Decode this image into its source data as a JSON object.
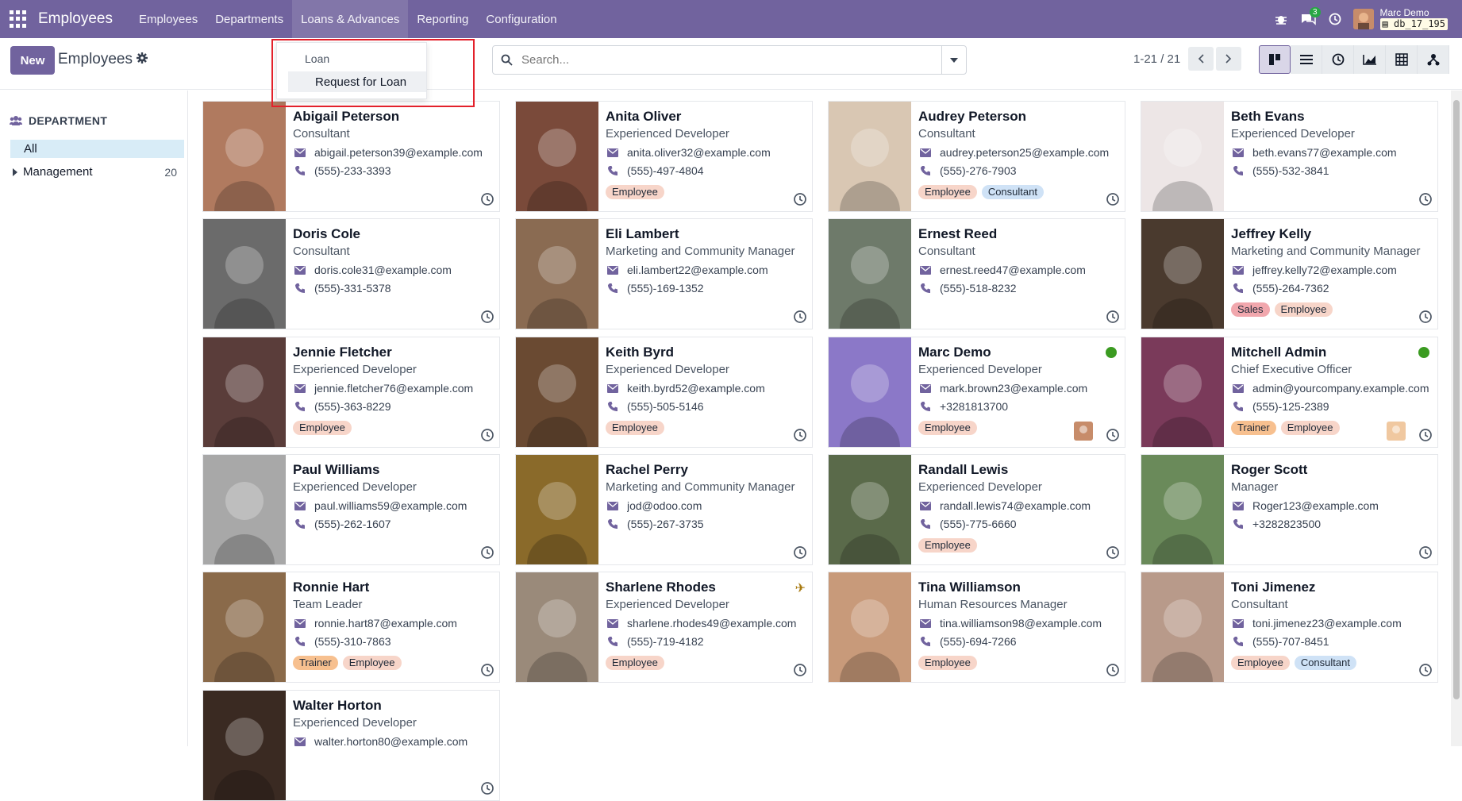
{
  "navbar": {
    "brand": "Employees",
    "menu": [
      "Employees",
      "Departments",
      "Loans & Advances",
      "Reporting",
      "Configuration"
    ],
    "messages_count": "3",
    "user_name": "Marc Demo",
    "db_name": "db_17_195"
  },
  "control": {
    "new_label": "New",
    "title": "Employees",
    "search_placeholder": "Search...",
    "pager": "1-21 / 21"
  },
  "loans_dropdown": {
    "header": "Loan",
    "item": "Request for Loan"
  },
  "sidebar": {
    "title": "DEPARTMENT",
    "all_label": "All",
    "items": [
      {
        "label": "Management",
        "count": "20"
      }
    ]
  },
  "colors": {
    "brand": "#71639e",
    "accent": "#d8ecf7",
    "online": "#3b9b21"
  },
  "employees": [
    {
      "name": "Abigail Peterson",
      "job": "Consultant",
      "email": "abigail.peterson39@example.com",
      "phone": "(555)-233-3393",
      "tags": [],
      "photo": "#b07a5f"
    },
    {
      "name": "Anita Oliver",
      "job": "Experienced Developer",
      "email": "anita.oliver32@example.com",
      "phone": "(555)-497-4804",
      "tags": [
        "Employee"
      ],
      "photo": "#7a4a3a"
    },
    {
      "name": "Audrey Peterson",
      "job": "Consultant",
      "email": "audrey.peterson25@example.com",
      "phone": "(555)-276-7903",
      "tags": [
        "Employee",
        "Consultant"
      ],
      "photo": "#d9c7b3"
    },
    {
      "name": "Beth Evans",
      "job": "Experienced Developer",
      "email": "beth.evans77@example.com",
      "phone": "(555)-532-3841",
      "tags": [],
      "photo": "#ede6e6"
    },
    {
      "name": "Doris Cole",
      "job": "Consultant",
      "email": "doris.cole31@example.com",
      "phone": "(555)-331-5378",
      "tags": [],
      "photo": "#6b6b6b"
    },
    {
      "name": "Eli Lambert",
      "job": "Marketing and Community Manager",
      "email": "eli.lambert22@example.com",
      "phone": "(555)-169-1352",
      "tags": [],
      "photo": "#8a6b52"
    },
    {
      "name": "Ernest Reed",
      "job": "Consultant",
      "email": "ernest.reed47@example.com",
      "phone": "(555)-518-8232",
      "tags": [],
      "photo": "#6e7a6a"
    },
    {
      "name": "Jeffrey Kelly",
      "job": "Marketing and Community Manager",
      "email": "jeffrey.kelly72@example.com",
      "phone": "(555)-264-7362",
      "tags": [
        "Sales",
        "Employee"
      ],
      "photo": "#4a3a2e"
    },
    {
      "name": "Jennie Fletcher",
      "job": "Experienced Developer",
      "email": "jennie.fletcher76@example.com",
      "phone": "(555)-363-8229",
      "tags": [
        "Employee"
      ],
      "photo": "#5a3d3a"
    },
    {
      "name": "Keith Byrd",
      "job": "Experienced Developer",
      "email": "keith.byrd52@example.com",
      "phone": "(555)-505-5146",
      "tags": [
        "Employee"
      ],
      "photo": "#6a4a32"
    },
    {
      "name": "Marc Demo",
      "job": "Experienced Developer",
      "email": "mark.brown23@example.com",
      "phone": "+3281813700",
      "tags": [
        "Employee"
      ],
      "photo": "#8b78c8",
      "online": true,
      "mini": "#c78c6a"
    },
    {
      "name": "Mitchell Admin",
      "job": "Chief Executive Officer",
      "email": "admin@yourcompany.example.com",
      "phone": "(555)-125-2389",
      "tags": [
        "Trainer",
        "Employee"
      ],
      "photo": "#7a3a5a",
      "online": true,
      "mini": "#f0c8a0"
    },
    {
      "name": "Paul Williams",
      "job": "Experienced Developer",
      "email": "paul.williams59@example.com",
      "phone": "(555)-262-1607",
      "tags": [],
      "photo": "#a8a8a8"
    },
    {
      "name": "Rachel Perry",
      "job": "Marketing and Community Manager",
      "email": "jod@odoo.com",
      "phone": "(555)-267-3735",
      "tags": [],
      "photo": "#8a6a2a"
    },
    {
      "name": "Randall Lewis",
      "job": "Experienced Developer",
      "email": "randall.lewis74@example.com",
      "phone": "(555)-775-6660",
      "tags": [
        "Employee"
      ],
      "photo": "#5a6a4a"
    },
    {
      "name": "Roger Scott",
      "job": "Manager",
      "email": "Roger123@example.com",
      "phone": "+3282823500",
      "tags": [],
      "photo": "#6a8a5a"
    },
    {
      "name": "Ronnie Hart",
      "job": "Team Leader",
      "email": "ronnie.hart87@example.com",
      "phone": "(555)-310-7863",
      "tags": [
        "Trainer",
        "Employee"
      ],
      "photo": "#8a6a4a"
    },
    {
      "name": "Sharlene Rhodes",
      "job": "Experienced Developer",
      "email": "sharlene.rhodes49@example.com",
      "phone": "(555)-719-4182",
      "tags": [
        "Employee"
      ],
      "photo": "#9a8a7a",
      "away": true
    },
    {
      "name": "Tina Williamson",
      "job": "Human Resources Manager",
      "email": "tina.williamson98@example.com",
      "phone": "(555)-694-7266",
      "tags": [
        "Employee"
      ],
      "photo": "#c89a7a"
    },
    {
      "name": "Toni Jimenez",
      "job": "Consultant",
      "email": "toni.jimenez23@example.com",
      "phone": "(555)-707-8451",
      "tags": [
        "Employee",
        "Consultant"
      ],
      "photo": "#b89a8a"
    },
    {
      "name": "Walter Horton",
      "job": "Experienced Developer",
      "email": "walter.horton80@example.com",
      "phone": "",
      "tags": [],
      "photo": "#3a2a22"
    }
  ]
}
